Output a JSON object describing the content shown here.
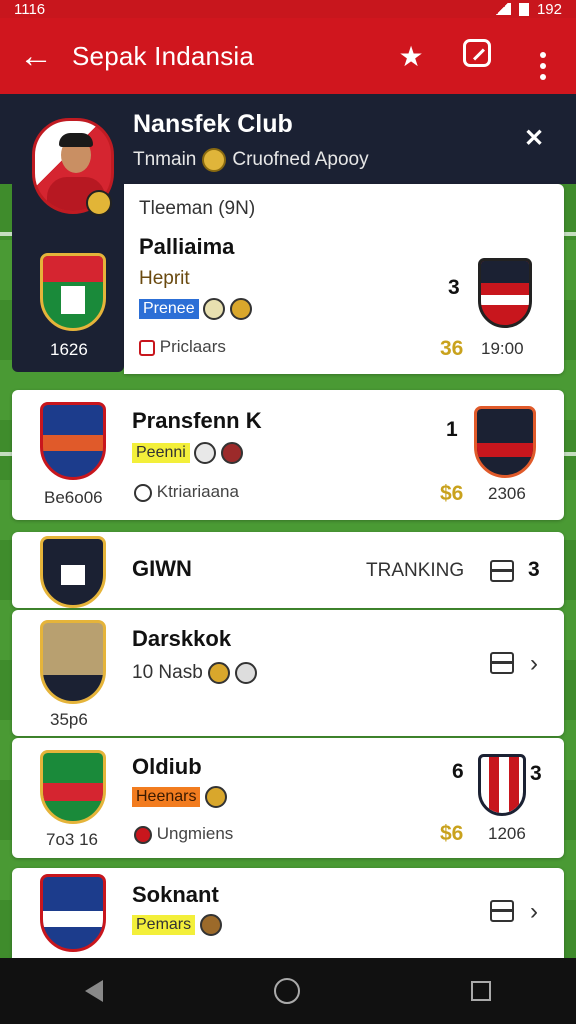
{
  "status": {
    "time": "1116",
    "right": "192"
  },
  "appbar": {
    "title": "Sepak Indansia"
  },
  "header": {
    "club_name": "Nansfek Club",
    "subtitle_left": "Tnmain",
    "subtitle_right": "Cruofned Apooy",
    "year": "1626"
  },
  "first_card": {
    "heading": "Tleeman (9N)",
    "player": "Palliaima",
    "position": "Heprit",
    "tag": "Prenee",
    "footer": "Priclaars",
    "score": "3",
    "gold": "36",
    "time": "19:00"
  },
  "rows": [
    {
      "name": "Pransfenn K",
      "tag": "Peenni",
      "footer": "Ktriariaana",
      "year": "Be6o06",
      "score": "1",
      "gold": "$6",
      "value": "2306"
    },
    {
      "name": "GIWN",
      "label": "TRANKING",
      "count": "3"
    },
    {
      "name": "Darskkok",
      "meta": "10 Nasb",
      "year": "35p6"
    },
    {
      "name": "Oldiub",
      "tag": "Heenars",
      "footer": "Ungmiens",
      "year": "7o3 16",
      "score": "6",
      "score2": "3",
      "gold": "$6",
      "value": "1206"
    },
    {
      "name": "Soknant",
      "tag": "Pemars"
    }
  ],
  "colors": {
    "brand": "#d0161e",
    "dark": "#1b2133",
    "gold": "#c9a21d",
    "pitch": "#4a9a34"
  },
  "icons": [
    "back-arrow-icon",
    "star-icon",
    "edit-icon",
    "more-icon",
    "close-icon",
    "list-icon",
    "chevron-right-icon"
  ]
}
